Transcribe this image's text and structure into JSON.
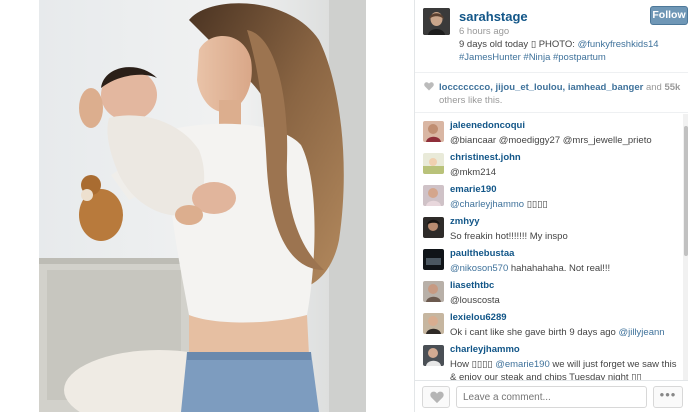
{
  "post": {
    "username": "sarahstage",
    "time": "6 hours ago",
    "caption_part1": "9 days old today ",
    "caption_glyph": "▯",
    "caption_part2": " PHOTO: ",
    "caption_link": "@funkyfreshkids14",
    "caption_tags": "#JamesHunter #Ninja #postpartum",
    "follow_label": "Follow"
  },
  "likes": {
    "users": "loccccccco, jijou_et_loulou, iamhead_banger",
    "and": " and ",
    "count": "55k",
    "suffix": " others like this."
  },
  "comments": [
    {
      "user": "jaleenedoncoqui",
      "text": "@biancaar @moediggy27 @mrs_jewelle_prieto",
      "mentions": true
    },
    {
      "user": "christinest.john",
      "text": "@mkm214",
      "mentions": true
    },
    {
      "user": "emarie190",
      "mention": "@charleyjhammo",
      "rest": " ▯▯▯▯"
    },
    {
      "user": "zmhyy",
      "text": "So freakin hot!!!!!!! My inspo"
    },
    {
      "user": "paulthebustaa",
      "mention": "@nikoson570",
      "rest": " hahahahaha. Not real!!!"
    },
    {
      "user": "liasethtbc",
      "text": "@louscosta",
      "mentions": true
    },
    {
      "user": "lexielou6289",
      "pre": "Ok i cant like she gave birth 9 days ago ",
      "mention": "@jillyjeann"
    },
    {
      "user": "charleyjhammo",
      "pre": "How ▯▯▯▯ ",
      "mention": "@emarie190",
      "rest": " we will just forget we saw this & enjoy our steak and chips Tuesday night ▯▯"
    }
  ],
  "comment_box": {
    "placeholder": "Leave a comment..."
  },
  "more_label": "•••",
  "icons": {
    "likes_heart": "heart-icon",
    "like_button": "heart-icon",
    "more": "more-dots-icon"
  },
  "colors": {
    "username": "#125688",
    "link": "#3f729b",
    "follow_bg": "#6f97b6",
    "muted": "#999999"
  }
}
